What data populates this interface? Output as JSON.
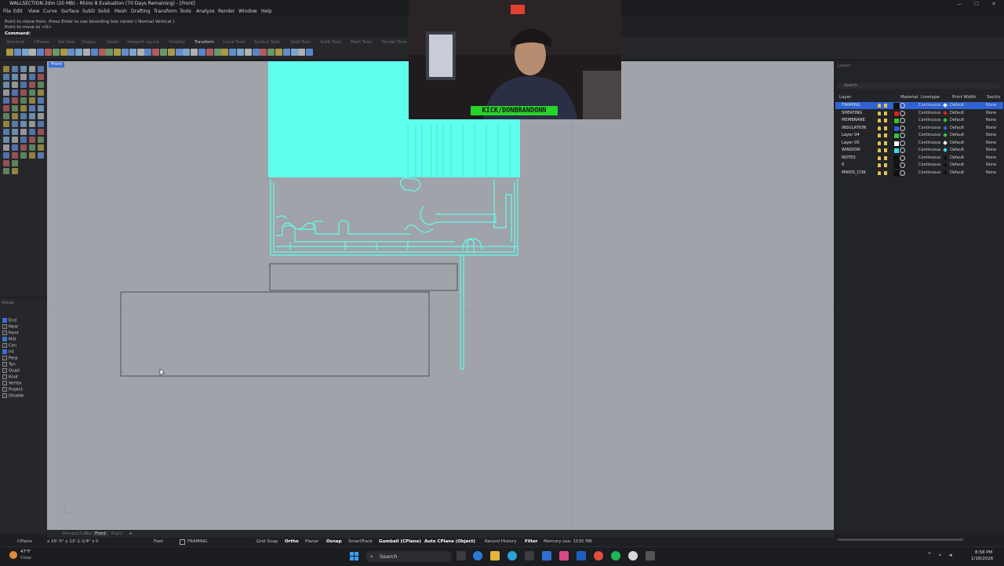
{
  "window": {
    "title": "WALLSECTION.3dm (20 MB) - Rhino 8 Evaluation (70 Days Remaining) - [Front]"
  },
  "menu": [
    "File",
    "Edit",
    "View",
    "Curve",
    "Surface",
    "SubD",
    "Solid",
    "Mesh",
    "Drafting",
    "Transform",
    "Tools",
    "Analyze",
    "Render",
    "Window",
    "Help"
  ],
  "command": {
    "line1": "Point to move from. Press Enter to use bounding box center ( Normal Vertical )",
    "line2": "Point to move to <0>",
    "prompt": "Command:"
  },
  "toolbar_tabs": [
    "Standard",
    "CPlanes",
    "Set View",
    "Display",
    "Select",
    "Viewport Layout",
    "Visibility",
    "Transform",
    "Curve Tools",
    "Surface Tools",
    "Solid Tools",
    "SubD Tools",
    "Mesh Tools",
    "Render Tools"
  ],
  "active_toolbar_tab": "Transform",
  "viewport": {
    "label": "Front",
    "background": "#a0a3a9",
    "accent": "#5fffee"
  },
  "osnap": {
    "options": [
      {
        "label": "End",
        "checked": true
      },
      {
        "label": "Near",
        "checked": false
      },
      {
        "label": "Point",
        "checked": false
      },
      {
        "label": "Mid",
        "checked": true
      },
      {
        "label": "Cen",
        "checked": false
      },
      {
        "label": "Int",
        "checked": true
      },
      {
        "label": "Perp",
        "checked": false
      },
      {
        "label": "Tan",
        "checked": false
      },
      {
        "label": "Quad",
        "checked": false
      },
      {
        "label": "Knot",
        "checked": false
      },
      {
        "label": "Vertex",
        "checked": false
      },
      {
        "label": "Project",
        "checked": false
      },
      {
        "label": "Disable",
        "checked": false
      }
    ]
  },
  "layers": {
    "search_placeholder": "Search",
    "columns": [
      "Layer",
      "Material",
      "Linetype",
      "Print Width",
      "Sectio"
    ],
    "rows": [
      {
        "name": "FRAMING",
        "color": "#111111",
        "linetype": "Continuous",
        "pw": "Default",
        "sec": "None",
        "pwcolor": "#ffffff",
        "selected": true
      },
      {
        "name": "SHEATING",
        "color": "#e02020",
        "linetype": "Continuous",
        "pw": "Default",
        "sec": "None",
        "pwcolor": "#e02020",
        "selected": false
      },
      {
        "name": "MEMBRANE",
        "color": "#35c43a",
        "linetype": "Continuous",
        "pw": "Default",
        "sec": "None",
        "pwcolor": "#35c43a",
        "selected": false
      },
      {
        "name": "INSULATION",
        "color": "#2f5fe0",
        "linetype": "Continuous",
        "pw": "Default",
        "sec": "None",
        "pwcolor": "#2f5fe0",
        "selected": false
      },
      {
        "name": "Layer 04",
        "color": "#35c43a",
        "linetype": "Continuous",
        "pw": "Default",
        "sec": "None",
        "pwcolor": "#35c43a",
        "selected": false
      },
      {
        "name": "Layer 05",
        "color": "#ffffff",
        "linetype": "Continuous",
        "pw": "Default",
        "sec": "None",
        "pwcolor": "#ffffff",
        "selected": false
      },
      {
        "name": "WINDOW",
        "color": "#33e0e6",
        "linetype": "Continuous",
        "pw": "Default",
        "sec": "None",
        "pwcolor": "#33e0e6",
        "selected": false
      },
      {
        "name": "NOTES",
        "color": "#111111",
        "linetype": "Continuous",
        "pw": "Default",
        "sec": "None",
        "pwcolor": "#111111",
        "selected": false
      },
      {
        "name": "0",
        "color": "#111111",
        "linetype": "Continuous",
        "pw": "Default",
        "sec": "None",
        "pwcolor": "#111111",
        "selected": false
      },
      {
        "name": "MWDS_COR",
        "color": "#111111",
        "linetype": "Continuous",
        "pw": "Default",
        "sec": "None",
        "pwcolor": "#111111",
        "selected": false
      }
    ]
  },
  "viewport_tabs": [
    "Perspective",
    "Top",
    "Front",
    "Right"
  ],
  "active_viewport_tab": "Front",
  "status": {
    "cplane": "CPlane",
    "coords": "x 16'-5\"   y 13'-1-1/4\"   z 0",
    "units": "Feet",
    "layer": "FRAMING",
    "grid_snap": "Grid Snap",
    "ortho": "Ortho",
    "planar": "Planar",
    "osnap": "Osnap",
    "smarttrack": "SmartTrack",
    "gumball": "Gumball (CPlane)",
    "autocplane": "Auto CPlane (Object)",
    "record_history": "Record History",
    "filter": "Filter",
    "memory": "Memory use: 1530 MB"
  },
  "webcam": {
    "label": "KICK/DONBRANDONN"
  },
  "taskbar": {
    "weather_temp": "47°F",
    "weather_desc": "Clear",
    "search": "Search",
    "time": "8:58 PM",
    "date": "1/18/2026"
  }
}
